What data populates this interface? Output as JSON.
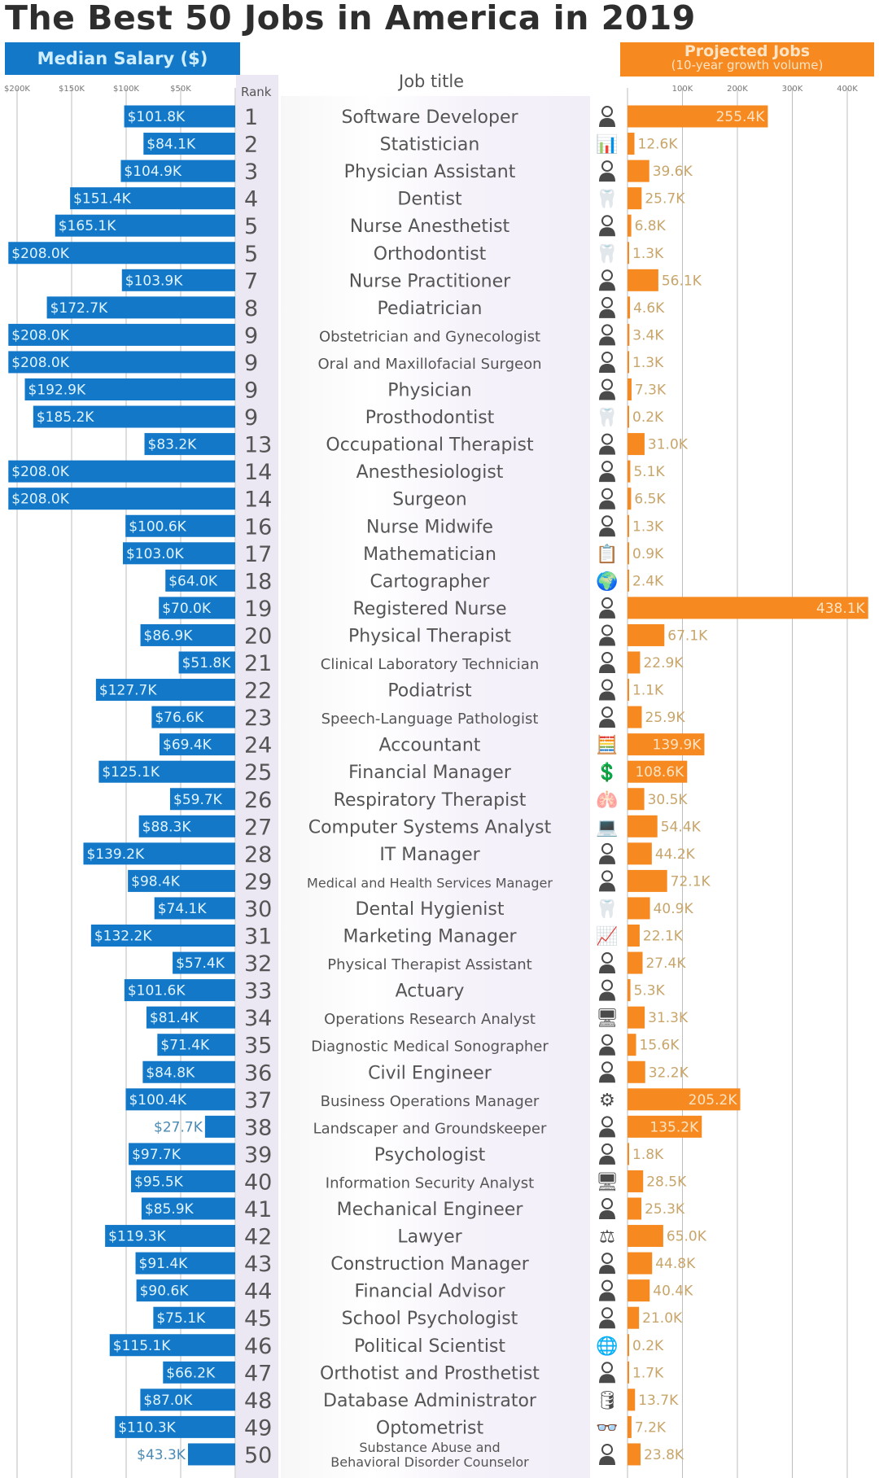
{
  "title": "The Best 50 Jobs in America in 2019",
  "headers": {
    "salary": "Median Salary ($)",
    "jobs_line1": "Projected Jobs",
    "jobs_line2": "(10-year growth volume)",
    "rank": "Rank",
    "job_title": "Job title"
  },
  "colors": {
    "salary_bar": "#1478c8",
    "jobs_bar": "#f6891f",
    "grid": "#bdbdbd"
  },
  "chart_data": {
    "type": "bar",
    "title": "The Best 50 Jobs in America in 2019",
    "series": [
      {
        "name": "Median Salary ($)",
        "unit": "K USD",
        "direction": "left",
        "axis_ticks": [
          "$200K",
          "$150K",
          "$100K",
          "$50K"
        ],
        "axis_tick_values": [
          200,
          150,
          100,
          50
        ],
        "xlim": [
          0,
          200
        ]
      },
      {
        "name": "Projected Jobs (10-year growth volume)",
        "unit": "K jobs",
        "direction": "right",
        "axis_ticks": [
          "100K",
          "200K",
          "300K",
          "400K"
        ],
        "axis_tick_values": [
          100,
          200,
          300,
          400
        ],
        "xlim": [
          0,
          400
        ]
      }
    ],
    "grid": true,
    "rows": [
      {
        "rank": "1",
        "title": "Software Developer",
        "icon": "developer-icon",
        "salary": 101.8,
        "salary_label": "$101.8K",
        "jobs": 255.4,
        "jobs_label": "255.4K"
      },
      {
        "rank": "2",
        "title": "Statistician",
        "icon": "chart-circle-icon",
        "salary": 84.1,
        "salary_label": "$84.1K",
        "jobs": 12.6,
        "jobs_label": "12.6K"
      },
      {
        "rank": "3",
        "title": "Physician Assistant",
        "icon": "doctor-icon",
        "salary": 104.9,
        "salary_label": "$104.9K",
        "jobs": 39.6,
        "jobs_label": "39.6K"
      },
      {
        "rank": "4",
        "title": "Dentist",
        "icon": "tooth-icon",
        "salary": 151.4,
        "salary_label": "$151.4K",
        "jobs": 25.7,
        "jobs_label": "25.7K"
      },
      {
        "rank": "5",
        "title": "Nurse Anesthetist",
        "icon": "nurse-syringe-icon",
        "salary": 165.1,
        "salary_label": "$165.1K",
        "jobs": 6.8,
        "jobs_label": "6.8K"
      },
      {
        "rank": "5",
        "title": "Orthodontist",
        "icon": "braces-icon",
        "salary": 208.0,
        "salary_label": "$208.0K",
        "jobs": 1.3,
        "jobs_label": "1.3K"
      },
      {
        "rank": "7",
        "title": "Nurse Practitioner",
        "icon": "nurse-stethoscope-icon",
        "salary": 103.9,
        "salary_label": "$103.9K",
        "jobs": 56.1,
        "jobs_label": "56.1K"
      },
      {
        "rank": "8",
        "title": "Pediatrician",
        "icon": "parent-child-icon",
        "salary": 172.7,
        "salary_label": "$172.7K",
        "jobs": 4.6,
        "jobs_label": "4.6K"
      },
      {
        "rank": "9",
        "title": "Obstetrician and Gynecologist",
        "icon": "obgyn-icon",
        "salary": 208.0,
        "salary_label": "$208.0K",
        "jobs": 3.4,
        "jobs_label": "3.4K"
      },
      {
        "rank": "9",
        "title": "Oral and Maxillofacial Surgeon",
        "icon": "surgeon-face-icon",
        "salary": 208.0,
        "salary_label": "$208.0K",
        "jobs": 1.3,
        "jobs_label": "1.3K"
      },
      {
        "rank": "9",
        "title": "Physician",
        "icon": "physician-icon",
        "salary": 192.9,
        "salary_label": "$192.9K",
        "jobs": 7.3,
        "jobs_label": "7.3K"
      },
      {
        "rank": "9",
        "title": "Prosthodontist",
        "icon": "tooth-implant-icon",
        "salary": 185.2,
        "salary_label": "$185.2K",
        "jobs": 0.2,
        "jobs_label": "0.2K"
      },
      {
        "rank": "13",
        "title": "Occupational Therapist",
        "icon": "therapist-icon",
        "salary": 83.2,
        "salary_label": "$83.2K",
        "jobs": 31.0,
        "jobs_label": "31.0K"
      },
      {
        "rank": "14",
        "title": "Anesthesiologist",
        "icon": "anesthesiologist-icon",
        "salary": 208.0,
        "salary_label": "$208.0K",
        "jobs": 5.1,
        "jobs_label": "5.1K"
      },
      {
        "rank": "14",
        "title": "Surgeon",
        "icon": "surgeon-icon",
        "salary": 208.0,
        "salary_label": "$208.0K",
        "jobs": 6.5,
        "jobs_label": "6.5K"
      },
      {
        "rank": "16",
        "title": "Nurse Midwife",
        "icon": "midwife-icon",
        "salary": 100.6,
        "salary_label": "$100.6K",
        "jobs": 1.3,
        "jobs_label": "1.3K"
      },
      {
        "rank": "17",
        "title": "Mathematician",
        "icon": "math-board-icon",
        "salary": 103.0,
        "salary_label": "$103.0K",
        "jobs": 0.9,
        "jobs_label": "0.9K"
      },
      {
        "rank": "18",
        "title": "Cartographer",
        "icon": "globe-person-icon",
        "salary": 64.0,
        "salary_label": "$64.0K",
        "jobs": 2.4,
        "jobs_label": "2.4K"
      },
      {
        "rank": "19",
        "title": "Registered Nurse",
        "icon": "nurse-clipboard-icon",
        "salary": 70.0,
        "salary_label": "$70.0K",
        "jobs": 438.1,
        "jobs_label": "438.1K"
      },
      {
        "rank": "20",
        "title": "Physical Therapist",
        "icon": "massage-icon",
        "salary": 86.9,
        "salary_label": "$86.9K",
        "jobs": 67.1,
        "jobs_label": "67.1K"
      },
      {
        "rank": "21",
        "title": "Clinical Laboratory Technician",
        "icon": "lab-tech-icon",
        "salary": 51.8,
        "salary_label": "$51.8K",
        "jobs": 22.9,
        "jobs_label": "22.9K"
      },
      {
        "rank": "22",
        "title": "Podiatrist",
        "icon": "foot-doctor-icon",
        "salary": 127.7,
        "salary_label": "$127.7K",
        "jobs": 1.1,
        "jobs_label": "1.1K"
      },
      {
        "rank": "23",
        "title": "Speech-Language Pathologist",
        "icon": "speech-icon",
        "salary": 76.6,
        "salary_label": "$76.6K",
        "jobs": 25.9,
        "jobs_label": "25.9K"
      },
      {
        "rank": "24",
        "title": "Accountant",
        "icon": "calculator-person-icon",
        "salary": 69.4,
        "salary_label": "$69.4K",
        "jobs": 139.9,
        "jobs_label": "139.9K"
      },
      {
        "rank": "25",
        "title": "Financial Manager",
        "icon": "dollar-person-icon",
        "salary": 125.1,
        "salary_label": "$125.1K",
        "jobs": 108.6,
        "jobs_label": "108.6K"
      },
      {
        "rank": "26",
        "title": "Respiratory Therapist",
        "icon": "lungs-icon",
        "salary": 59.7,
        "salary_label": "$59.7K",
        "jobs": 30.5,
        "jobs_label": "30.5K"
      },
      {
        "rank": "27",
        "title": "Computer Systems Analyst",
        "icon": "laptop-chart-icon",
        "salary": 88.3,
        "salary_label": "$88.3K",
        "jobs": 54.4,
        "jobs_label": "54.4K"
      },
      {
        "rank": "28",
        "title": "IT Manager",
        "icon": "computer-user-icon",
        "salary": 139.2,
        "salary_label": "$139.2K",
        "jobs": 44.2,
        "jobs_label": "44.2K"
      },
      {
        "rank": "29",
        "title": "Medical and Health Services Manager",
        "icon": "medical-manager-icon",
        "salary": 98.4,
        "salary_label": "$98.4K",
        "jobs": 72.1,
        "jobs_label": "72.1K"
      },
      {
        "rank": "30",
        "title": "Dental Hygienist",
        "icon": "tooth-cycle-icon",
        "salary": 74.1,
        "salary_label": "$74.1K",
        "jobs": 40.9,
        "jobs_label": "40.9K"
      },
      {
        "rank": "31",
        "title": "Marketing Manager",
        "icon": "presentation-icon",
        "salary": 132.2,
        "salary_label": "$132.2K",
        "jobs": 22.1,
        "jobs_label": "22.1K"
      },
      {
        "rank": "32",
        "title": "Physical Therapist Assistant",
        "icon": "therapy-assist-icon",
        "salary": 57.4,
        "salary_label": "$57.4K",
        "jobs": 27.4,
        "jobs_label": "27.4K"
      },
      {
        "rank": "33",
        "title": "Actuary",
        "icon": "actuary-icon",
        "salary": 101.6,
        "salary_label": "$101.6K",
        "jobs": 5.3,
        "jobs_label": "5.3K"
      },
      {
        "rank": "34",
        "title": "Operations Research Analyst",
        "icon": "monitor-search-icon",
        "salary": 81.4,
        "salary_label": "$81.4K",
        "jobs": 31.3,
        "jobs_label": "31.3K"
      },
      {
        "rank": "35",
        "title": "Diagnostic Medical Sonographer",
        "icon": "ultrasound-icon",
        "salary": 71.4,
        "salary_label": "$71.4K",
        "jobs": 15.6,
        "jobs_label": "15.6K"
      },
      {
        "rank": "36",
        "title": "Civil Engineer",
        "icon": "engineer-icon",
        "salary": 84.8,
        "salary_label": "$84.8K",
        "jobs": 32.2,
        "jobs_label": "32.2K"
      },
      {
        "rank": "37",
        "title": "Business Operations Manager",
        "icon": "gears-person-icon",
        "salary": 100.4,
        "salary_label": "$100.4K",
        "jobs": 205.2,
        "jobs_label": "205.2K"
      },
      {
        "rank": "38",
        "title": "Landscaper and Groundskeeper",
        "icon": "landscaper-icon",
        "salary": 27.7,
        "salary_label": "$27.7K",
        "jobs": 135.2,
        "jobs_label": "135.2K"
      },
      {
        "rank": "39",
        "title": "Psychologist",
        "icon": "psychologist-icon",
        "salary": 97.7,
        "salary_label": "$97.7K",
        "jobs": 1.8,
        "jobs_label": "1.8K"
      },
      {
        "rank": "40",
        "title": "Information Security Analyst",
        "icon": "monitor-lock-icon",
        "salary": 95.5,
        "salary_label": "$95.5K",
        "jobs": 28.5,
        "jobs_label": "28.5K"
      },
      {
        "rank": "41",
        "title": "Mechanical Engineer",
        "icon": "mech-engineer-icon",
        "salary": 85.9,
        "salary_label": "$85.9K",
        "jobs": 25.3,
        "jobs_label": "25.3K"
      },
      {
        "rank": "42",
        "title": "Lawyer",
        "icon": "scales-icon",
        "salary": 119.3,
        "salary_label": "$119.3K",
        "jobs": 65.0,
        "jobs_label": "65.0K"
      },
      {
        "rank": "43",
        "title": "Construction Manager",
        "icon": "hardhat-icon",
        "salary": 91.4,
        "salary_label": "$91.4K",
        "jobs": 44.8,
        "jobs_label": "44.8K"
      },
      {
        "rank": "44",
        "title": "Financial Advisor",
        "icon": "advisor-icon",
        "salary": 90.6,
        "salary_label": "$90.6K",
        "jobs": 40.4,
        "jobs_label": "40.4K"
      },
      {
        "rank": "45",
        "title": "School Psychologist",
        "icon": "teacher-child-icon",
        "salary": 75.1,
        "salary_label": "$75.1K",
        "jobs": 21.0,
        "jobs_label": "21.0K"
      },
      {
        "rank": "46",
        "title": "Political Scientist",
        "icon": "globe-graduate-icon",
        "salary": 115.1,
        "salary_label": "$115.1K",
        "jobs": 0.2,
        "jobs_label": "0.2K"
      },
      {
        "rank": "47",
        "title": "Orthotist and Prosthetist",
        "icon": "prosthetic-icon",
        "salary": 66.2,
        "salary_label": "$66.2K",
        "jobs": 1.7,
        "jobs_label": "1.7K"
      },
      {
        "rank": "48",
        "title": "Database Administrator",
        "icon": "database-icon",
        "salary": 87.0,
        "salary_label": "$87.0K",
        "jobs": 13.7,
        "jobs_label": "13.7K"
      },
      {
        "rank": "49",
        "title": "Optometrist",
        "icon": "glasses-icon",
        "salary": 110.3,
        "salary_label": "$110.3K",
        "jobs": 7.2,
        "jobs_label": "7.2K"
      },
      {
        "rank": "50",
        "title": "Substance Abuse and Behavioral Disorder Counselor",
        "title_lines": [
          "Substance Abuse and",
          "Behavioral Disorder Counselor"
        ],
        "icon": "counselor-icon",
        "salary": 43.3,
        "salary_label": "$43.3K",
        "jobs": 23.8,
        "jobs_label": "23.8K"
      }
    ]
  }
}
